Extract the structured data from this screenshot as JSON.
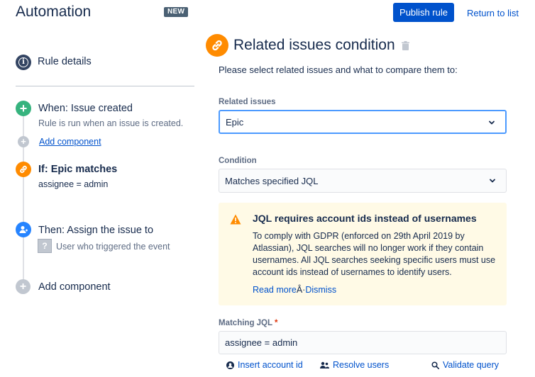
{
  "app": {
    "title": "Automation",
    "badge": "NEW"
  },
  "header": {
    "publish_label": "Publish rule",
    "return_label": "Return to list"
  },
  "sidebar": {
    "rule_details": "Rule details",
    "trigger": {
      "label": "When: Issue created",
      "sub": "Rule is run when an issue is created."
    },
    "add_component_link": "Add component",
    "condition": {
      "label": "If: Epic matches",
      "sub": "assignee = admin"
    },
    "action": {
      "label": "Then: Assign the issue to",
      "sub": "User who triggered the event"
    },
    "add_component": "Add component"
  },
  "panel": {
    "title": "Related issues condition",
    "description": "Please select related issues and what to compare them to:",
    "related_label": "Related issues",
    "related_value": "Epic",
    "condition_label": "Condition",
    "condition_value": "Matches specified JQL",
    "warning": {
      "title": "JQL requires account ids instead of usernames",
      "body": "To comply with GDPR (enforced on 29th April 2019 by Atlassian), JQL searches will no longer work if they contain usernames. All JQL searches seeking specific users must use account ids instead of usernames to identify users.",
      "read_more": "Read more",
      "separator": "Â·",
      "dismiss": "Dismiss"
    },
    "jql_label": "Matching JQL",
    "jql_required": "*",
    "jql_value": "assignee = admin",
    "actions": {
      "insert": "Insert account id",
      "resolve": "Resolve users",
      "validate": "Validate query"
    }
  },
  "colors": {
    "accent": "#0052cc",
    "trigger": "#36b37e",
    "condition": "#ff8b00",
    "action": "#2684ff",
    "warning_bg": "#fffae6"
  }
}
